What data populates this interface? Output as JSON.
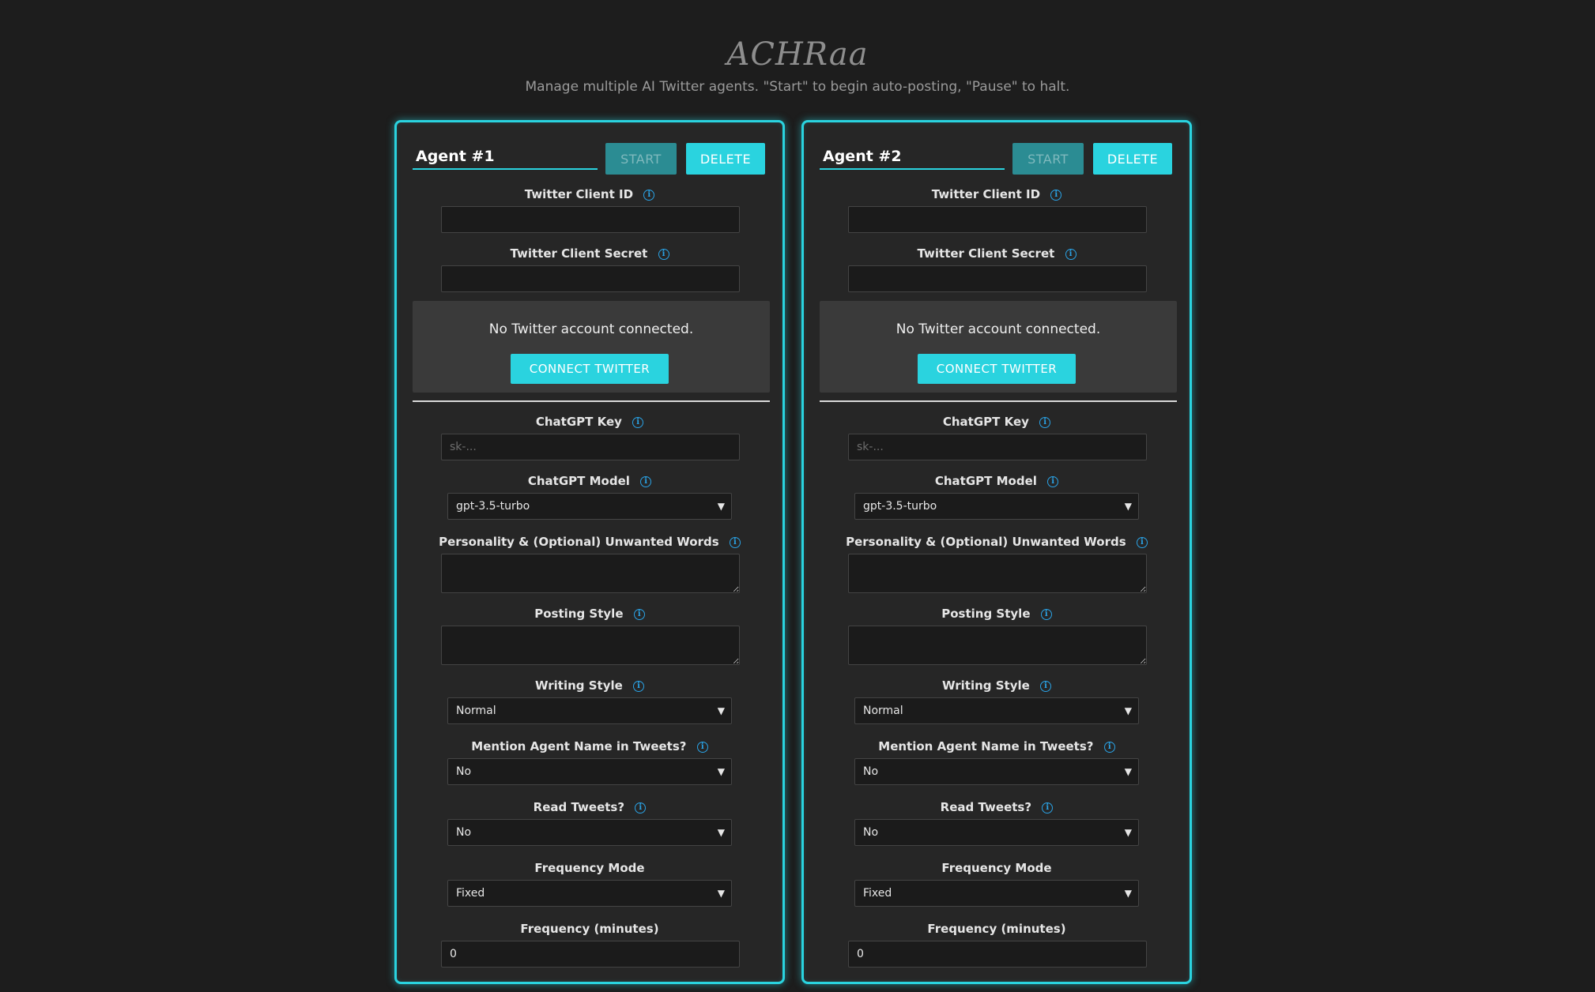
{
  "header": {
    "logo_text": "ACHRaa",
    "subtitle": "Manage multiple AI Twitter agents. \"Start\" to begin auto-posting, \"Pause\" to halt."
  },
  "colors": {
    "accent": "#2ad3df",
    "background": "#1d1d1d",
    "card": "#262626",
    "info_icon": "#2aa3e6"
  },
  "labels": {
    "start": "START",
    "delete": "DELETE",
    "twitter_client_id": "Twitter Client ID",
    "twitter_client_secret": "Twitter Client Secret",
    "connect_status": "No Twitter account connected.",
    "connect_button": "CONNECT TWITTER",
    "chatgpt_key": "ChatGPT Key",
    "chatgpt_key_placeholder": "sk-...",
    "chatgpt_model": "ChatGPT Model",
    "personality": "Personality & (Optional) Unwanted Words",
    "posting_style": "Posting Style",
    "writing_style": "Writing Style",
    "mention_name": "Mention Agent Name in Tweets?",
    "read_tweets": "Read Tweets?",
    "frequency_mode": "Frequency Mode",
    "frequency_minutes": "Frequency (minutes)",
    "info_glyph": "i"
  },
  "agents": [
    {
      "name": "Agent #1",
      "twitter_client_id": "",
      "twitter_client_secret": "",
      "chatgpt_key": "",
      "chatgpt_model": "gpt-3.5-turbo",
      "personality": "",
      "posting_style": "",
      "writing_style": "Normal",
      "mention_name": "No",
      "read_tweets": "No",
      "frequency_mode": "Fixed",
      "frequency_minutes": "0"
    },
    {
      "name": "Agent #2",
      "twitter_client_id": "",
      "twitter_client_secret": "",
      "chatgpt_key": "",
      "chatgpt_model": "gpt-3.5-turbo",
      "personality": "",
      "posting_style": "",
      "writing_style": "Normal",
      "mention_name": "No",
      "read_tweets": "No",
      "frequency_mode": "Fixed",
      "frequency_minutes": "0"
    }
  ],
  "icons": {
    "info": "info-icon",
    "chevron": "chevron-down-icon"
  }
}
